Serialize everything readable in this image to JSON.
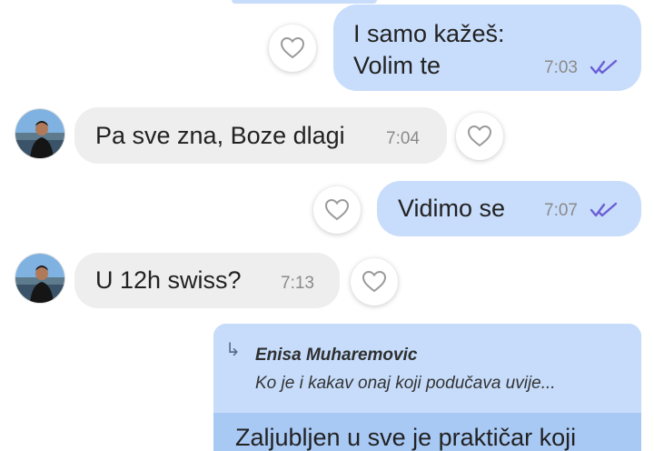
{
  "colors": {
    "outgoing_bubble": "#c8ddfb",
    "incoming_bubble": "#eeeeee",
    "read_ticks": "#6b5fd6",
    "reply_card": "#c6dcfa"
  },
  "messages": [
    {
      "direction": "outgoing",
      "lines": [
        "I samo kažeš:",
        "Volim te"
      ],
      "time": "7:03",
      "status_icon": "double-check-icon"
    },
    {
      "direction": "incoming",
      "text": "Pa sve zna, Boze dlagi",
      "time": "7:04"
    },
    {
      "direction": "outgoing",
      "text": "Vidimo se",
      "time": "7:07",
      "status_icon": "double-check-icon"
    },
    {
      "direction": "incoming",
      "text": "U 12h swiss?",
      "time": "7:13"
    }
  ],
  "reply": {
    "icon": "reply-arrow-icon",
    "author": "Enisa Muharemovic",
    "quote": "Ko je i kakav onaj koji podučava uvije...",
    "partial_text": "Zaljubljen u sve je praktičar koji"
  }
}
